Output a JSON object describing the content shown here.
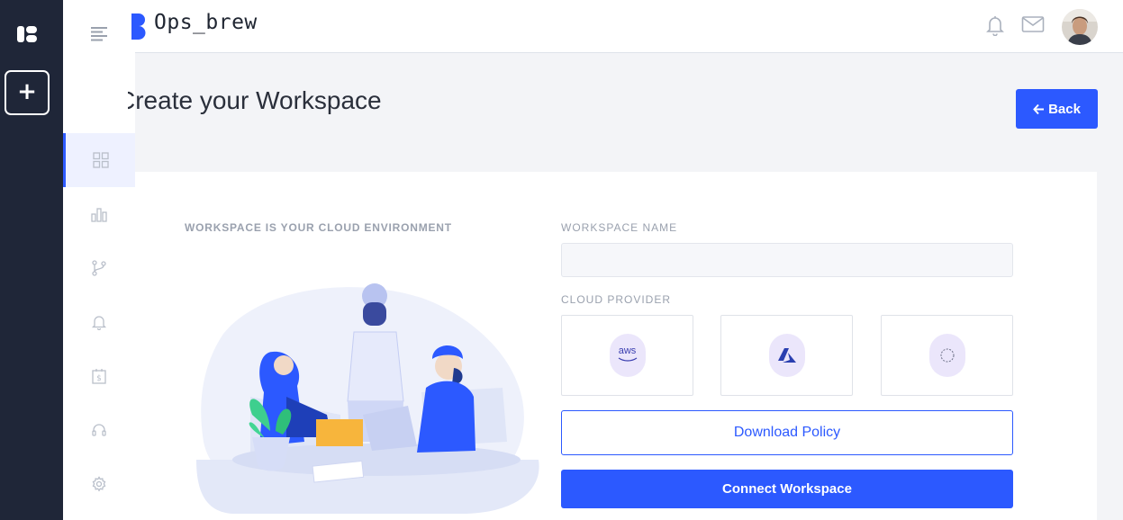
{
  "brand": {
    "name": "Ops_brew"
  },
  "rail": {
    "add_label": "+"
  },
  "page": {
    "title": "Create your Workspace",
    "back_label": "Back"
  },
  "form": {
    "caption": "WORKSPACE IS YOUR CLOUD ENVIRONMENT",
    "name_label": "WORKSPACE NAME",
    "name_value": "",
    "provider_label": "CLOUD PROVIDER",
    "providers": [
      {
        "name": "aws",
        "icon": "aws-icon"
      },
      {
        "name": "azure",
        "icon": "azure-icon"
      },
      {
        "name": "gcp",
        "icon": "gcp-icon"
      }
    ],
    "download_label": "Download Policy",
    "connect_label": "Connect Workspace"
  },
  "colors": {
    "accent": "#2c59ff",
    "rail": "#1f2638",
    "background": "#f3f4f7"
  }
}
